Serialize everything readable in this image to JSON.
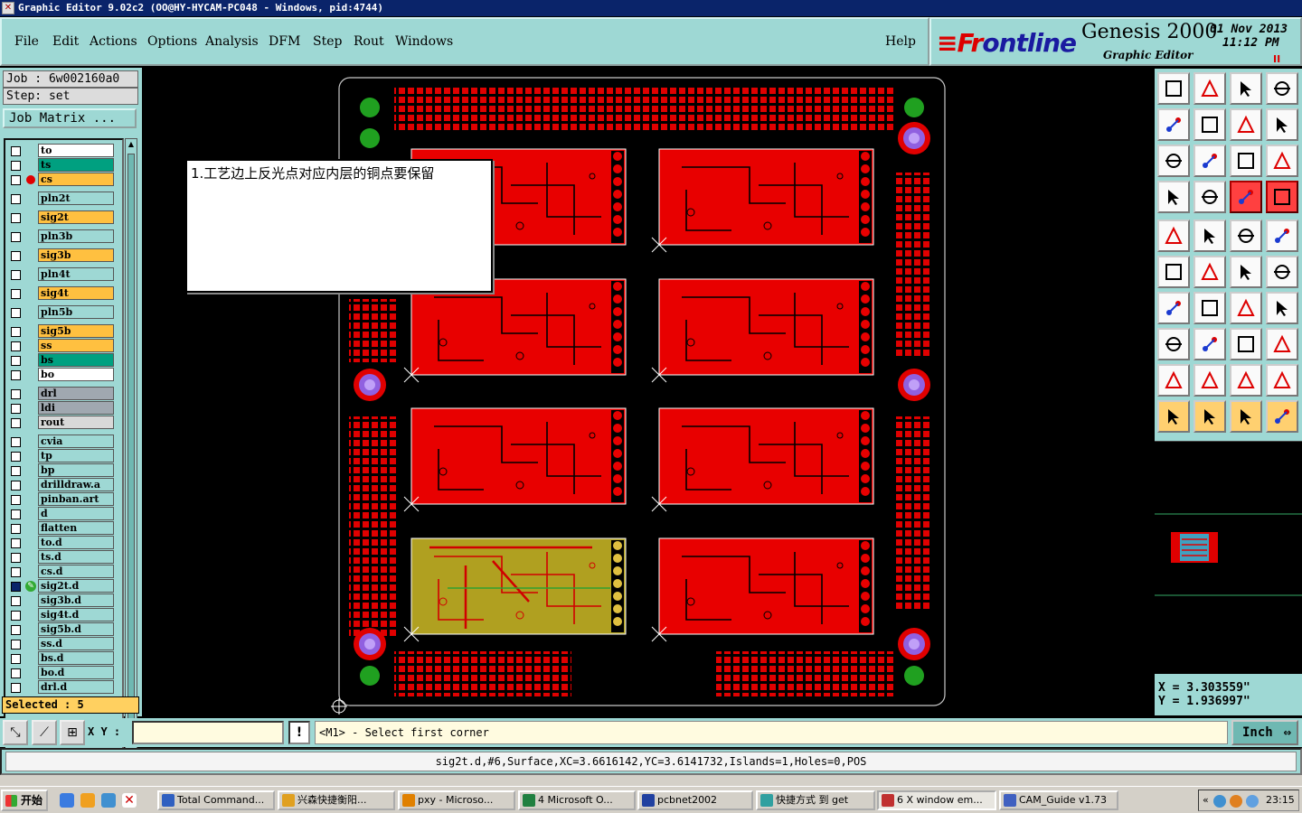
{
  "window": {
    "title": "Graphic Editor 9.02c2  (OO@HY-HYCAM-PC048 - Windows, pid:4744)",
    "icon": "app-icon"
  },
  "menu": {
    "items": [
      "File",
      "Edit",
      "Actions",
      "Options",
      "Analysis",
      "DFM",
      "Step",
      "Rout",
      "Windows"
    ],
    "help": "Help"
  },
  "brand": {
    "logo_a": "Fr",
    "logo_b": "ontline",
    "logo_prefix": "≡",
    "product": "Genesis 2000",
    "subtitle": "Graphic Editor",
    "date": "01 Nov 2013",
    "time": "11:12 PM",
    "pause": "II"
  },
  "job": {
    "job_line": "Job : 6w002160a0",
    "step_line": "Step: set",
    "matrix_button": "Job Matrix ..."
  },
  "layers": [
    {
      "name": "to",
      "color": "#ffffff",
      "marker": ""
    },
    {
      "name": "ts",
      "color": "#00a080",
      "marker": ""
    },
    {
      "name": "cs",
      "color": "#ffc040",
      "marker": "red-dot"
    },
    {
      "name": "pln2t",
      "color": "#9ed8d4",
      "marker": "",
      "gap": true
    },
    {
      "name": "sig2t",
      "color": "#ffc040",
      "marker": "",
      "gap": true
    },
    {
      "name": "pln3b",
      "color": "#9ed8d4",
      "marker": "",
      "gap": true
    },
    {
      "name": "sig3b",
      "color": "#ffc040",
      "marker": "",
      "gap": true
    },
    {
      "name": "pln4t",
      "color": "#9ed8d4",
      "marker": "",
      "gap": true
    },
    {
      "name": "sig4t",
      "color": "#ffc040",
      "marker": "",
      "gap": true
    },
    {
      "name": "pln5b",
      "color": "#9ed8d4",
      "marker": "",
      "gap": true
    },
    {
      "name": "sig5b",
      "color": "#ffc040",
      "marker": "",
      "gap": true
    },
    {
      "name": "ss",
      "color": "#ffc040",
      "marker": ""
    },
    {
      "name": "bs",
      "color": "#00a080",
      "marker": ""
    },
    {
      "name": "bo",
      "color": "#ffffff",
      "marker": ""
    },
    {
      "name": "drl",
      "color": "#a0a8b0",
      "marker": "",
      "gap": true
    },
    {
      "name": "ldi",
      "color": "#a0a8b0",
      "marker": ""
    },
    {
      "name": "rout",
      "color": "#d8d8d8",
      "marker": ""
    },
    {
      "name": "cvia",
      "color": "#9ed8d4",
      "marker": "",
      "gap": true
    },
    {
      "name": "tp",
      "color": "#9ed8d4",
      "marker": ""
    },
    {
      "name": "bp",
      "color": "#9ed8d4",
      "marker": ""
    },
    {
      "name": "drilldraw.a",
      "color": "#9ed8d4",
      "marker": ""
    },
    {
      "name": "pinban.art",
      "color": "#9ed8d4",
      "marker": ""
    },
    {
      "name": "d",
      "color": "#9ed8d4",
      "marker": ""
    },
    {
      "name": "flatten",
      "color": "#9ed8d4",
      "marker": ""
    },
    {
      "name": "to.d",
      "color": "#9ed8d4",
      "marker": ""
    },
    {
      "name": "ts.d",
      "color": "#9ed8d4",
      "marker": ""
    },
    {
      "name": "cs.d",
      "color": "#9ed8d4",
      "marker": ""
    },
    {
      "name": "sig2t.d",
      "color": "#9ed8d4",
      "marker": "edit",
      "active": true
    },
    {
      "name": "sig3b.d",
      "color": "#9ed8d4",
      "marker": ""
    },
    {
      "name": "sig4t.d",
      "color": "#9ed8d4",
      "marker": ""
    },
    {
      "name": "sig5b.d",
      "color": "#9ed8d4",
      "marker": ""
    },
    {
      "name": "ss.d",
      "color": "#9ed8d4",
      "marker": ""
    },
    {
      "name": "bs.d",
      "color": "#9ed8d4",
      "marker": ""
    },
    {
      "name": "bo.d",
      "color": "#9ed8d4",
      "marker": ""
    },
    {
      "name": "drl.d",
      "color": "#9ed8d4",
      "marker": ""
    }
  ],
  "selected": "Selected : 5",
  "note": {
    "text": "1.工艺边上反光点对应内层的铜点要保留"
  },
  "tools": [
    {
      "name": "home-icon",
      "style": ""
    },
    {
      "name": "step-down-icon",
      "style": ""
    },
    {
      "name": "building-icon",
      "style": ""
    },
    {
      "name": "split-view-icon",
      "style": ""
    },
    {
      "name": "pan-left-icon",
      "style": ""
    },
    {
      "name": "pan-right-icon",
      "style": ""
    },
    {
      "name": "mirror-icon",
      "style": ""
    },
    {
      "name": "redraw-icon",
      "style": ""
    },
    {
      "name": "zoom-fit-icon",
      "style": ""
    },
    {
      "name": "zoom-center-icon",
      "style": ""
    },
    {
      "name": "scale-1-2-icon",
      "style": ""
    },
    {
      "name": "query-icon",
      "style": ""
    },
    {
      "name": "settings-icon",
      "style": ""
    },
    {
      "name": "grid-icon",
      "style": ""
    },
    {
      "name": "snap-a-icon",
      "style": "hl"
    },
    {
      "name": "snap-b-icon",
      "style": "hl"
    },
    {
      "name": "select-pad-icon",
      "style": ""
    },
    {
      "name": "draw-shape-icon",
      "style": ""
    },
    {
      "name": "ruler-icon",
      "style": ""
    },
    {
      "name": "dot-icon",
      "style": ""
    },
    {
      "name": "connect-icon",
      "style": ""
    },
    {
      "name": "cross-icon",
      "style": ""
    },
    {
      "name": "line-dots-icon",
      "style": ""
    },
    {
      "name": "line-dot-icon",
      "style": ""
    },
    {
      "name": "angle-icon",
      "style": ""
    },
    {
      "name": "slash-icon",
      "style": ""
    },
    {
      "name": "arc-icon",
      "style": ""
    },
    {
      "name": "ff-icon",
      "style": ""
    },
    {
      "name": "nodes-icon",
      "style": ""
    },
    {
      "name": "segment-icon",
      "style": ""
    },
    {
      "name": "measure-icon",
      "style": ""
    },
    {
      "name": "circles-icon",
      "style": ""
    },
    {
      "name": "triangle-a-icon",
      "style": ""
    },
    {
      "name": "triangle-b-icon",
      "style": ""
    },
    {
      "name": "triangle-c-icon",
      "style": ""
    },
    {
      "name": "triangle-d-icon",
      "style": ""
    },
    {
      "name": "pointer-icon",
      "style": "yl"
    },
    {
      "name": "pointer-box-icon",
      "style": "yl"
    },
    {
      "name": "pointer-frame-icon",
      "style": "yl"
    },
    {
      "name": "path-edit-icon",
      "style": "yl"
    }
  ],
  "coords": {
    "x": "X = 3.303559\"",
    "y": "Y = 1.936997\""
  },
  "bottombar": {
    "xy_label": "X Y :",
    "xy_value": "",
    "excl": "!",
    "prompt": "<M1> - Select first corner",
    "unit": "Inch"
  },
  "status": "sig2t.d,#6,Surface,XC=3.6616142,YC=3.6141732,Islands=1,Holes=0,POS",
  "taskbar": {
    "start": "开始",
    "tasks": [
      {
        "label": "Total Command...",
        "icon_color": "#3060c0",
        "active": false
      },
      {
        "label": "兴森快捷衡阳...",
        "icon_color": "#e0a020",
        "active": false
      },
      {
        "label": "pxy - Microso...",
        "icon_color": "#e08000",
        "active": false
      },
      {
        "label": "4 Microsoft O...",
        "icon_color": "#208040",
        "active": false
      },
      {
        "label": "pcbnet2002",
        "icon_color": "#2040a0",
        "active": false
      },
      {
        "label": "快捷方式 到 get",
        "icon_color": "#30a0a0",
        "active": false
      },
      {
        "label": "6 X window em...",
        "icon_color": "#c03030",
        "active": true
      },
      {
        "label": "CAM_Guide v1.73",
        "icon_color": "#4060c0",
        "active": false
      }
    ],
    "clock": "23:15"
  }
}
